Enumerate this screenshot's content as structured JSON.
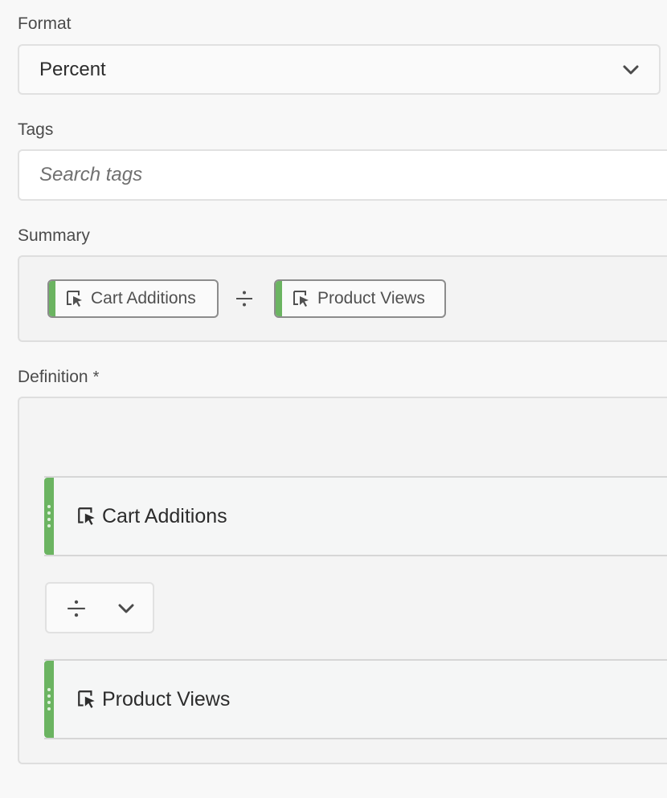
{
  "format": {
    "label": "Format",
    "selected": "Percent",
    "icon": "chevron-down-icon"
  },
  "tags": {
    "label": "Tags",
    "placeholder": "Search tags"
  },
  "summary": {
    "label": "Summary",
    "items": [
      {
        "label": "Cart Additions",
        "icon": "metric-cursor-icon"
      },
      {
        "label": "Product Views",
        "icon": "metric-cursor-icon"
      }
    ],
    "operator_icon": "divide-icon"
  },
  "definition": {
    "label": "Definition",
    "required_mark": "*",
    "metrics": [
      {
        "label": "Cart Additions",
        "icon": "metric-cursor-icon"
      },
      {
        "label": "Product Views",
        "icon": "metric-cursor-icon"
      }
    ],
    "operator": {
      "icon": "divide-icon",
      "dropdown_icon": "chevron-down-icon"
    }
  },
  "colors": {
    "metric_accent": "#6bb461",
    "border": "#e1e1e1",
    "text": "#2c2c2c"
  }
}
